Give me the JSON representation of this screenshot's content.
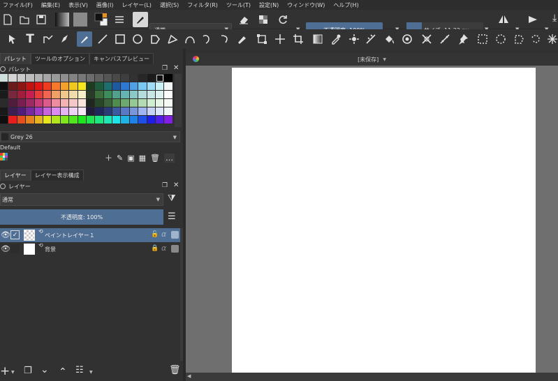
{
  "menubar": {
    "items": [
      {
        "label": "ファイル(F)"
      },
      {
        "label": "編集(E)"
      },
      {
        "label": "表示(V)"
      },
      {
        "label": "画像(I)"
      },
      {
        "label": "レイヤー(L)"
      },
      {
        "label": "選択(S)"
      },
      {
        "label": "フィルタ(R)"
      },
      {
        "label": "ツール(T)"
      },
      {
        "label": "設定(N)"
      },
      {
        "label": "ウィンドウ(W)"
      },
      {
        "label": "ヘルプ(H)"
      }
    ]
  },
  "toolbar": {
    "blend_mode": "通常",
    "opacity": "不透明度: 100%",
    "size": "サイズ: 11.22 px"
  },
  "tools": {
    "icons": [
      "select-shapes-icon",
      "text-icon",
      "edit-shapes-icon",
      "calligraphy-icon",
      "freehand-brush-icon",
      "line-icon",
      "rectangle-icon",
      "ellipse-icon",
      "polygon-icon",
      "polyline-icon",
      "bezier-icon",
      "freehand-path-icon",
      "dynamic-brush-icon",
      "multibrush-icon",
      "transform-icon",
      "move-icon",
      "crop-icon",
      "gradient-icon",
      "color-sampler-icon",
      "assistant-icon",
      "measure-icon",
      "fill-icon",
      "colorize-mask-icon",
      "smart-patch-icon",
      "reference-image-icon",
      "rect-select-icon",
      "ellipse-select-icon",
      "polygon-select-icon",
      "freehand-select-icon",
      "contiguous-select-icon"
    ]
  },
  "dock": {
    "tabs": [
      {
        "label": "パレット"
      },
      {
        "label": "ツールのオプション"
      },
      {
        "label": "キャンバスプレビュー"
      }
    ],
    "palette": {
      "title": "パレット",
      "selected_color_name": "Grey 26",
      "palette_name": "Default",
      "colors": [
        "#cfe0df",
        "#d4d4d4",
        "#c9c9c9",
        "#bdbdbd",
        "#b2b2b2",
        "#a6a6a6",
        "#9a9a9a",
        "#8f8f8f",
        "#838383",
        "#787878",
        "#6c6c6c",
        "#606060",
        "#555555",
        "#494949",
        "#3e3e3e",
        "#323232",
        "#272727",
        "#1b1b1b",
        "#101010",
        "#030303",
        "#101010",
        "#6a1b1b",
        "#8f1414",
        "#c41212",
        "#e31616",
        "#f03c1e",
        "#f5782d",
        "#f5a02d",
        "#f0c81e",
        "#f5e61e",
        "#1e3c1e",
        "#1e5a3c",
        "#1e6e6e",
        "#1e5aa0",
        "#2d78d2",
        "#50a0e6",
        "#78c8f0",
        "#a0dcf5",
        "#c8f0f5",
        "#f0f5f5",
        "#1b1b1b",
        "#78283c",
        "#a01e3c",
        "#c81e50",
        "#e63c3c",
        "#f06450",
        "#f0a064",
        "#f0c88c",
        "#f0dcaa",
        "#f5f0c8",
        "#283c28",
        "#3c6e3c",
        "#3c8c5a",
        "#50a08c",
        "#64b4b4",
        "#8cc8c8",
        "#b4dcdc",
        "#c8e6e6",
        "#dcf0f0",
        "#ffffff",
        "#2b2b2b",
        "#501e3c",
        "#781e50",
        "#a02864",
        "#c83c78",
        "#dc5a8c",
        "#f08ca0",
        "#f5b4b4",
        "#f5c8c8",
        "#fae6dc",
        "#1e281e",
        "#284628",
        "#3c643c",
        "#508c50",
        "#6eaa6e",
        "#96c896",
        "#b4dcb4",
        "#d2eed2",
        "#e6f5e6",
        "#f5faf5",
        "#191919",
        "#3c1e50",
        "#501e78",
        "#7828a0",
        "#a03cc8",
        "#c864dc",
        "#dc8cf0",
        "#e6b4f5",
        "#f0d2f5",
        "#f5e6fa",
        "#1e1e3c",
        "#1e285a",
        "#283c78",
        "#3c5aa0",
        "#5a78c8",
        "#7896dc",
        "#a0b4f0",
        "#c8d2f5",
        "#dce6fa",
        "#f0f5fa",
        "#0f0f0f",
        "#e61e1e",
        "#e6501e",
        "#e6821e",
        "#e6b41e",
        "#e6e61e",
        "#b4e61e",
        "#82e61e",
        "#50e61e",
        "#1ee61e",
        "#1ee650",
        "#1ee682",
        "#1ee6b4",
        "#1ee6e6",
        "#1eb4e6",
        "#1e82e6",
        "#1e50e6",
        "#1e1ee6",
        "#501ee6",
        "#821ee6"
      ]
    },
    "layers_tabs": [
      {
        "label": "レイヤー"
      },
      {
        "label": "レイヤー表示構成"
      }
    ],
    "layers": {
      "title": "レイヤー",
      "blend_mode": "通常",
      "opacity": "不透明度: 100%",
      "items": [
        {
          "name": "ペイントレイヤー１",
          "selected": true
        },
        {
          "name": "背景",
          "selected": false
        }
      ]
    }
  },
  "canvas": {
    "title": "[未保存]"
  },
  "colors": {
    "accent": "#4f6e94",
    "background": "#313131",
    "canvas_bg": "#6f6f6f"
  }
}
